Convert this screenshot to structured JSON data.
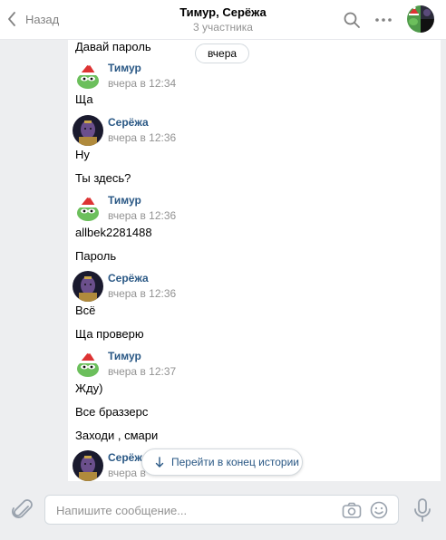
{
  "header": {
    "back_label": "Назад",
    "title": "Тимур, Серёжа",
    "subtitle": "3 участника"
  },
  "date_separator": "вчера",
  "messages": {
    "m0": "Давай пароль",
    "a1": {
      "name": "Тимур",
      "time": "вчера в 12:34"
    },
    "m1": "Ща",
    "a2": {
      "name": "Серёжа",
      "time": "вчера в 12:36"
    },
    "m2": "Ну",
    "m3": "Ты здесь?",
    "a3": {
      "name": "Тимур",
      "time": "вчера в 12:36"
    },
    "m4": "allbek2281488",
    "m5": "Пароль",
    "a4": {
      "name": "Серёжа",
      "time": "вчера в 12:36"
    },
    "m6": "Всё",
    "m7": "Ща проверю",
    "a5": {
      "name": "Тимур",
      "time": "вчера в 12:37"
    },
    "m8": "Жду)",
    "m9": "Все браззерс",
    "m10": "Заходи , смари",
    "a6": {
      "name": "Серёж",
      "time": "вчера в"
    }
  },
  "jump_to_end_label": "Перейти в конец истории",
  "composer": {
    "placeholder": "Напишите сообщение..."
  },
  "colors": {
    "link": "#2a5885",
    "muted": "#939393",
    "background": "#edeef0",
    "border": "#d3d9de"
  }
}
